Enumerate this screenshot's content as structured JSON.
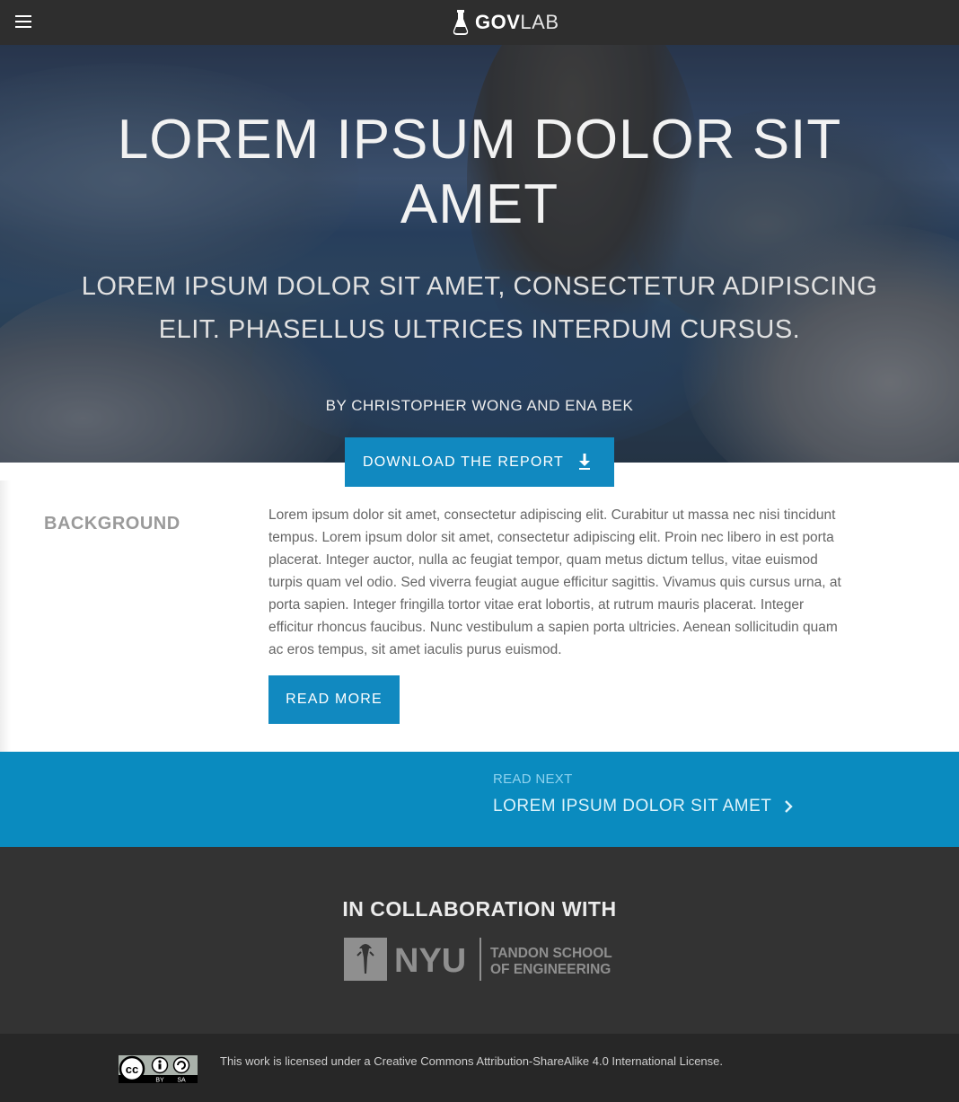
{
  "header": {
    "menu_icon": "hamburger-menu-icon",
    "logo": {
      "bold": "GOV",
      "light": "LAB",
      "icon": "flask-icon"
    }
  },
  "hero": {
    "title": "LOREM IPSUM DOLOR SIT AMET",
    "subtitle": "LOREM IPSUM DOLOR SIT AMET, CONSECTETUR ADIPISCING ELIT. PHASELLUS ULTRICES INTERDUM CURSUS.",
    "byline": "BY CHRISTOPHER WONG AND ENA BEK",
    "download_label": "DOWNLOAD THE REPORT",
    "download_icon": "download-arrow-icon"
  },
  "background_section": {
    "heading": "BACKGROUND",
    "body": "Lorem ipsum dolor sit amet, consectetur adipiscing elit. Curabitur ut massa nec nisi tincidunt tempus. Lorem ipsum dolor sit amet, consectetur adipiscing elit. Proin nec libero in est porta placerat. Integer auctor, nulla ac feugiat tempor, quam metus dictum tellus, vitae euismod turpis quam vel odio. Sed viverra feugiat augue efficitur sagittis. Vivamus quis cursus urna, at porta sapien. Integer fringilla tortor vitae erat lobortis, at rutrum mauris placerat. Integer efficitur rhoncus faucibus. Nunc vestibulum a sapien porta ultricies. Aenean sollicitudin quam ac eros tempus, sit amet iaculis purus euismod.",
    "read_more_label": "READ MORE"
  },
  "read_next": {
    "label": "READ NEXT",
    "title": "LOREM IPSUM DOLOR SIT AMET",
    "icon": "chevron-right-icon"
  },
  "collaboration": {
    "heading": "IN COLLABORATION WITH",
    "partner": {
      "name": "NYU",
      "line1": "TANDON SCHOOL",
      "line2": "OF ENGINEERING"
    }
  },
  "footer": {
    "license_prefix": "This work is licensed under a ",
    "license_link": "Creative Commons Attribution-ShareAlike 4.0 International License",
    "license_suffix": ".",
    "badge_text": {
      "by": "BY",
      "sa": "SA"
    }
  },
  "colors": {
    "header_bg": "#2e2e2e",
    "accent_blue": "#1189c0",
    "read_next_band": "#0a8bbf",
    "collab_bg": "#333333",
    "footer_bg": "#272727"
  }
}
